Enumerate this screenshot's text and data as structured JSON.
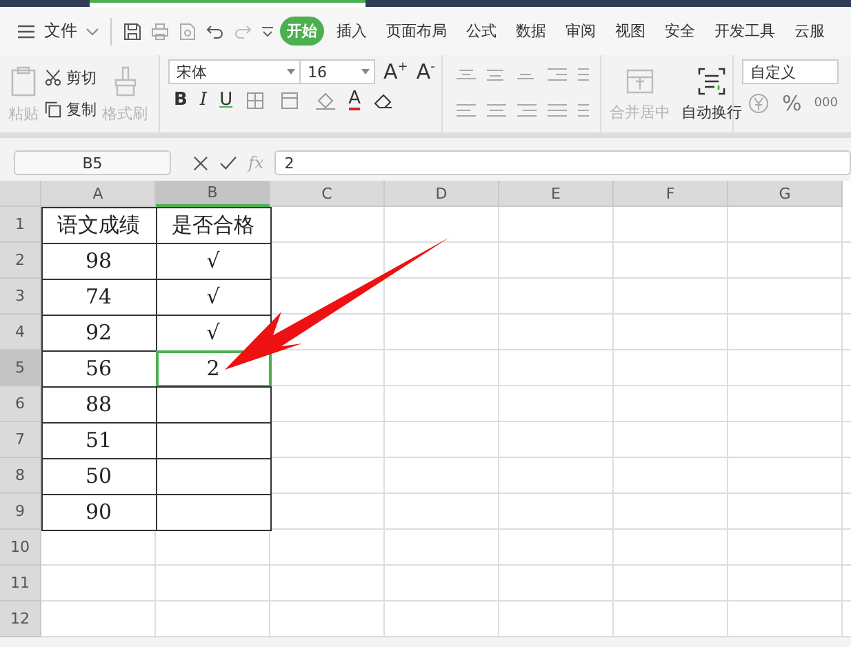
{
  "menu_bar": {
    "file_label": "文件",
    "tabs": [
      {
        "label": "开始",
        "selected": true
      },
      {
        "label": "插入",
        "selected": false
      },
      {
        "label": "页面布局",
        "selected": false
      },
      {
        "label": "公式",
        "selected": false
      },
      {
        "label": "数据",
        "selected": false
      },
      {
        "label": "审阅",
        "selected": false
      },
      {
        "label": "视图",
        "selected": false
      },
      {
        "label": "安全",
        "selected": false
      },
      {
        "label": "开发工具",
        "selected": false
      },
      {
        "label": "云服",
        "selected": false
      }
    ]
  },
  "ribbon": {
    "paste": {
      "label": "粘贴",
      "disabled": true
    },
    "cut": {
      "label": "剪切",
      "disabled": false
    },
    "copy": {
      "label": "复制",
      "disabled": false
    },
    "painter": {
      "label": "格式刷",
      "disabled": true
    },
    "font_family": "宋体",
    "font_size": "16",
    "grow": "A",
    "grow_mark": "+",
    "shrink": "A",
    "shrink_mark": "-",
    "styles": [
      {
        "kind": "bold",
        "glyph": "B"
      },
      {
        "kind": "italic",
        "glyph": "I"
      },
      {
        "kind": "underline",
        "glyph": "U"
      }
    ],
    "font_color": "A",
    "merge": {
      "label": "合并居中",
      "disabled": true
    },
    "wrap": {
      "label": "自动换行",
      "disabled": false
    },
    "number_format": "自定义",
    "percent": "%",
    "thousands": "000"
  },
  "formula_bar": {
    "name_box": "B5",
    "fx": "fx",
    "value": "2"
  },
  "sheet": {
    "columns": [
      {
        "label": "A",
        "selected": false
      },
      {
        "label": "B",
        "selected": true
      },
      {
        "label": "C",
        "selected": false
      },
      {
        "label": "D",
        "selected": false
      },
      {
        "label": "E",
        "selected": false
      },
      {
        "label": "F",
        "selected": false
      },
      {
        "label": "G",
        "selected": false
      }
    ],
    "rows": [
      {
        "label": "1",
        "selected": false,
        "cells": [
          {
            "text": "语文成绩",
            "border": true
          },
          {
            "text": "是否合格",
            "border": true
          }
        ]
      },
      {
        "label": "2",
        "selected": false,
        "cells": [
          {
            "text": "98",
            "border": true
          },
          {
            "text": "√",
            "border": true
          }
        ]
      },
      {
        "label": "3",
        "selected": false,
        "cells": [
          {
            "text": "74",
            "border": true
          },
          {
            "text": "√",
            "border": true
          }
        ]
      },
      {
        "label": "4",
        "selected": false,
        "cells": [
          {
            "text": "92",
            "border": true
          },
          {
            "text": "√",
            "border": true
          }
        ]
      },
      {
        "label": "5",
        "selected": true,
        "cells": [
          {
            "text": "56",
            "border": true
          },
          {
            "text": "2",
            "border": true
          }
        ]
      },
      {
        "label": "6",
        "selected": false,
        "cells": [
          {
            "text": "88",
            "border": true
          },
          {
            "border": true
          }
        ]
      },
      {
        "label": "7",
        "selected": false,
        "cells": [
          {
            "text": "51",
            "border": true
          },
          {
            "border": true
          }
        ]
      },
      {
        "label": "8",
        "selected": false,
        "cells": [
          {
            "text": "50",
            "border": true
          },
          {
            "border": true
          }
        ]
      },
      {
        "label": "9",
        "selected": false,
        "cells": [
          {
            "text": "90",
            "border": true
          },
          {
            "border": true
          }
        ]
      },
      {
        "label": "10",
        "selected": false,
        "cells": []
      },
      {
        "label": "11",
        "selected": false,
        "cells": []
      },
      {
        "label": "12",
        "selected": false,
        "cells": []
      }
    ]
  }
}
